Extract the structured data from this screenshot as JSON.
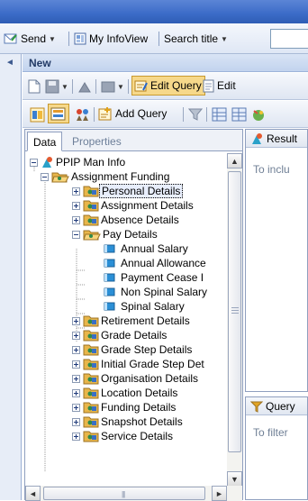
{
  "nav": {
    "send_label": "Send",
    "myinfoview_label": "My InfoView",
    "search_label": "Search title"
  },
  "header": {
    "title": "New"
  },
  "toolbar1": {
    "edit_query_label": "Edit Query",
    "edit_label": "Edit"
  },
  "toolbar2": {
    "add_query_label": "Add Query"
  },
  "left_panel": {
    "tabs": [
      {
        "label": "Data"
      },
      {
        "label": "Properties"
      }
    ],
    "tree": [
      {
        "label": "PPIP Man Info"
      },
      {
        "label": "Assignment Funding"
      },
      {
        "label": "Personal Details"
      },
      {
        "label": "Assignment Details"
      },
      {
        "label": "Absence Details"
      },
      {
        "label": "Pay Details"
      },
      {
        "label": "Annual Salary"
      },
      {
        "label": "Annual Allowance"
      },
      {
        "label": "Payment Cease I"
      },
      {
        "label": "Non Spinal Salary"
      },
      {
        "label": "Spinal Salary"
      },
      {
        "label": "Retirement Details"
      },
      {
        "label": "Grade Details"
      },
      {
        "label": "Grade Step Details"
      },
      {
        "label": "Initial Grade Step Det"
      },
      {
        "label": "Organisation Details"
      },
      {
        "label": "Location Details"
      },
      {
        "label": "Funding Details"
      },
      {
        "label": "Snapshot Details"
      },
      {
        "label": "Service Details"
      }
    ]
  },
  "right_panel": {
    "result_title": "Result",
    "result_hint": "To inclu",
    "query_title": "Query",
    "query_hint": "To filter"
  },
  "colors": {
    "topbar": "#3b6bc7",
    "folder": "#e8b64a",
    "object": "#2b8fd6",
    "selected": "#f6d88a"
  },
  "icons": [
    "send-icon",
    "infoview-icon",
    "folder-icon",
    "object-icon",
    "universe-icon",
    "filter-icon"
  ]
}
